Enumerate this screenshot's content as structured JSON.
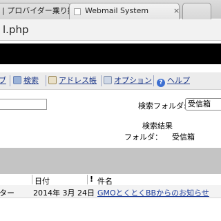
{
  "browser": {
    "tabs": [
      {
        "label": "| プロバイダー乗り換",
        "close": "×"
      },
      {
        "label": "Webmail System",
        "close": "×"
      }
    ],
    "url_fragment": "l.php"
  },
  "toolbar": {
    "partial_left": "ブ",
    "items": [
      {
        "label": "検索",
        "icon": "search-icon"
      },
      {
        "label": "アドレス帳",
        "icon": "address-book-icon"
      },
      {
        "label": "オプション",
        "icon": "options-icon"
      },
      {
        "label": "ヘルプ",
        "icon": "help-icon",
        "glyph": "?"
      }
    ]
  },
  "search": {
    "input_value": "",
    "folder_label": "検索フォルダ:",
    "folder_value": "受信箱"
  },
  "results": {
    "title": "検索結果",
    "folder_label": "フォルダ：",
    "folder_value": "受信箱"
  },
  "table": {
    "headers": {
      "from": "",
      "date": "日付",
      "flag": "!",
      "subject": "件名"
    },
    "rows": [
      {
        "from": "ター",
        "date": "2014年 3月 24日",
        "subject": "GMOとくとくBBからのお知らせ"
      }
    ]
  }
}
